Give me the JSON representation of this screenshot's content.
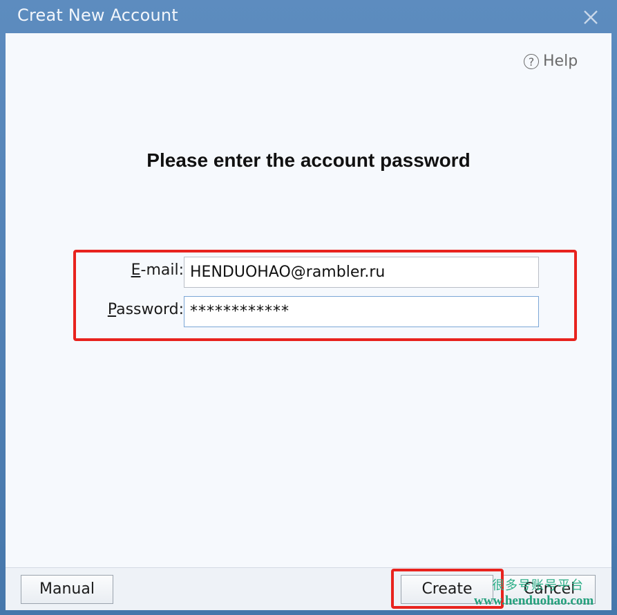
{
  "window": {
    "title": "Creat New Account",
    "close_icon": "close-icon"
  },
  "help": {
    "icon": "question-circle-icon",
    "icon_glyph": "?",
    "label": "Help"
  },
  "heading": "Please enter the account password",
  "form": {
    "email": {
      "label_mnemonic": "E",
      "label_rest": "-mail:",
      "value": "HENDUOHAO@rambler.ru"
    },
    "password": {
      "label_mnemonic": "P",
      "label_rest": "assword:",
      "value": "************"
    }
  },
  "buttons": {
    "manual": "Manual",
    "create": "Create",
    "cancel": "Cancel"
  },
  "watermark": {
    "text_cn": "很多号账号平台",
    "url": "www.henduohao.com"
  },
  "colors": {
    "titlebar": "#4a7cb0",
    "highlight": "#e8231e",
    "watermark": "#2cae87"
  }
}
